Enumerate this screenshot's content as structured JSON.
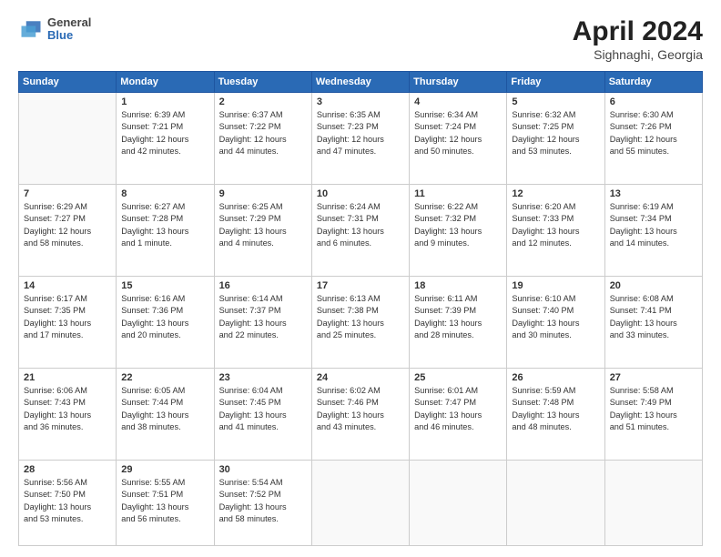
{
  "header": {
    "logo_line1": "General",
    "logo_line2": "Blue",
    "title": "April 2024",
    "location": "Sighnaghi, Georgia"
  },
  "weekdays": [
    "Sunday",
    "Monday",
    "Tuesday",
    "Wednesday",
    "Thursday",
    "Friday",
    "Saturday"
  ],
  "weeks": [
    [
      {
        "day": "",
        "info": ""
      },
      {
        "day": "1",
        "info": "Sunrise: 6:39 AM\nSunset: 7:21 PM\nDaylight: 12 hours\nand 42 minutes."
      },
      {
        "day": "2",
        "info": "Sunrise: 6:37 AM\nSunset: 7:22 PM\nDaylight: 12 hours\nand 44 minutes."
      },
      {
        "day": "3",
        "info": "Sunrise: 6:35 AM\nSunset: 7:23 PM\nDaylight: 12 hours\nand 47 minutes."
      },
      {
        "day": "4",
        "info": "Sunrise: 6:34 AM\nSunset: 7:24 PM\nDaylight: 12 hours\nand 50 minutes."
      },
      {
        "day": "5",
        "info": "Sunrise: 6:32 AM\nSunset: 7:25 PM\nDaylight: 12 hours\nand 53 minutes."
      },
      {
        "day": "6",
        "info": "Sunrise: 6:30 AM\nSunset: 7:26 PM\nDaylight: 12 hours\nand 55 minutes."
      }
    ],
    [
      {
        "day": "7",
        "info": "Sunrise: 6:29 AM\nSunset: 7:27 PM\nDaylight: 12 hours\nand 58 minutes."
      },
      {
        "day": "8",
        "info": "Sunrise: 6:27 AM\nSunset: 7:28 PM\nDaylight: 13 hours\nand 1 minute."
      },
      {
        "day": "9",
        "info": "Sunrise: 6:25 AM\nSunset: 7:29 PM\nDaylight: 13 hours\nand 4 minutes."
      },
      {
        "day": "10",
        "info": "Sunrise: 6:24 AM\nSunset: 7:31 PM\nDaylight: 13 hours\nand 6 minutes."
      },
      {
        "day": "11",
        "info": "Sunrise: 6:22 AM\nSunset: 7:32 PM\nDaylight: 13 hours\nand 9 minutes."
      },
      {
        "day": "12",
        "info": "Sunrise: 6:20 AM\nSunset: 7:33 PM\nDaylight: 13 hours\nand 12 minutes."
      },
      {
        "day": "13",
        "info": "Sunrise: 6:19 AM\nSunset: 7:34 PM\nDaylight: 13 hours\nand 14 minutes."
      }
    ],
    [
      {
        "day": "14",
        "info": "Sunrise: 6:17 AM\nSunset: 7:35 PM\nDaylight: 13 hours\nand 17 minutes."
      },
      {
        "day": "15",
        "info": "Sunrise: 6:16 AM\nSunset: 7:36 PM\nDaylight: 13 hours\nand 20 minutes."
      },
      {
        "day": "16",
        "info": "Sunrise: 6:14 AM\nSunset: 7:37 PM\nDaylight: 13 hours\nand 22 minutes."
      },
      {
        "day": "17",
        "info": "Sunrise: 6:13 AM\nSunset: 7:38 PM\nDaylight: 13 hours\nand 25 minutes."
      },
      {
        "day": "18",
        "info": "Sunrise: 6:11 AM\nSunset: 7:39 PM\nDaylight: 13 hours\nand 28 minutes."
      },
      {
        "day": "19",
        "info": "Sunrise: 6:10 AM\nSunset: 7:40 PM\nDaylight: 13 hours\nand 30 minutes."
      },
      {
        "day": "20",
        "info": "Sunrise: 6:08 AM\nSunset: 7:41 PM\nDaylight: 13 hours\nand 33 minutes."
      }
    ],
    [
      {
        "day": "21",
        "info": "Sunrise: 6:06 AM\nSunset: 7:43 PM\nDaylight: 13 hours\nand 36 minutes."
      },
      {
        "day": "22",
        "info": "Sunrise: 6:05 AM\nSunset: 7:44 PM\nDaylight: 13 hours\nand 38 minutes."
      },
      {
        "day": "23",
        "info": "Sunrise: 6:04 AM\nSunset: 7:45 PM\nDaylight: 13 hours\nand 41 minutes."
      },
      {
        "day": "24",
        "info": "Sunrise: 6:02 AM\nSunset: 7:46 PM\nDaylight: 13 hours\nand 43 minutes."
      },
      {
        "day": "25",
        "info": "Sunrise: 6:01 AM\nSunset: 7:47 PM\nDaylight: 13 hours\nand 46 minutes."
      },
      {
        "day": "26",
        "info": "Sunrise: 5:59 AM\nSunset: 7:48 PM\nDaylight: 13 hours\nand 48 minutes."
      },
      {
        "day": "27",
        "info": "Sunrise: 5:58 AM\nSunset: 7:49 PM\nDaylight: 13 hours\nand 51 minutes."
      }
    ],
    [
      {
        "day": "28",
        "info": "Sunrise: 5:56 AM\nSunset: 7:50 PM\nDaylight: 13 hours\nand 53 minutes."
      },
      {
        "day": "29",
        "info": "Sunrise: 5:55 AM\nSunset: 7:51 PM\nDaylight: 13 hours\nand 56 minutes."
      },
      {
        "day": "30",
        "info": "Sunrise: 5:54 AM\nSunset: 7:52 PM\nDaylight: 13 hours\nand 58 minutes."
      },
      {
        "day": "",
        "info": ""
      },
      {
        "day": "",
        "info": ""
      },
      {
        "day": "",
        "info": ""
      },
      {
        "day": "",
        "info": ""
      }
    ]
  ]
}
